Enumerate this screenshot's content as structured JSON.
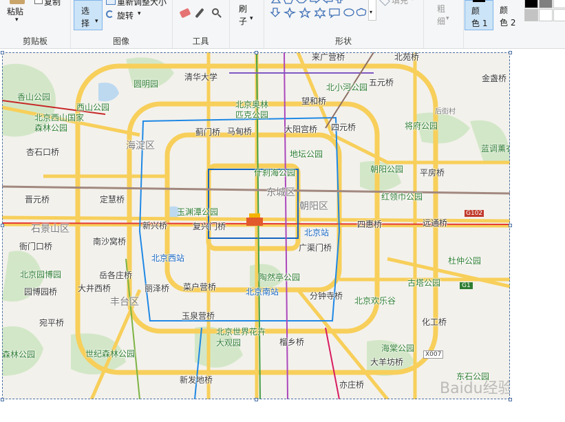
{
  "ribbon": {
    "clipboard": {
      "paste": "粘贴",
      "copy": "复制",
      "label": "剪贴板"
    },
    "image": {
      "select": "选\n择",
      "resize": "重新调整大小",
      "rotate": "旋转",
      "label": "图像"
    },
    "tools": {
      "label": "工具"
    },
    "brush": {
      "label": "刷\n子"
    },
    "shapes": {
      "label": "形状",
      "fill": "填充"
    },
    "size": {
      "label": "粗\n细"
    },
    "color1": "颜\n色 1",
    "color2": "颜\n色 2",
    "swatches": [
      "#000000",
      "#7f7f7f",
      "#ffffff",
      "#c3c3c3",
      "#ffffff",
      "#ffffff"
    ]
  },
  "map": {
    "districts": [
      "海淀区",
      "东城区",
      "朝阳区",
      "石景山区",
      "丰台区"
    ],
    "parks": [
      "香山公园",
      "北京西山国家森林公园",
      "圆明园",
      "北京奥林匹克公园",
      "北小河公园",
      "将府公园",
      "地坛公园",
      "什刹海公园",
      "朝阳公园",
      "红领巾公园",
      "玉渊潭公园",
      "杜仲公园",
      "北京园博园",
      "陶然亭公园",
      "古塔公园",
      "北京欢乐谷",
      "北京世界花卉大观园",
      "海棠公园",
      "世纪森林公园",
      "森林公园",
      "西山公园",
      "蓝调薰衣",
      "东石公园"
    ],
    "places": [
      "清华大学",
      "来广营桥",
      "北苑桥",
      "五元桥",
      "金盏桥",
      "望和桥",
      "四元桥",
      "蓟门桥",
      "马甸桥",
      "大阳宫桥",
      "后街村",
      "杏石口桥",
      "平房桥",
      "晋元桥",
      "定慧桥",
      "新兴桥",
      "复兴门桥",
      "四惠桥",
      "远通桥",
      "衙门口桥",
      "南沙窝桥",
      "广渠门桥",
      "岳各庄桥",
      "大井西桥",
      "丽泽桥",
      "菜户营桥",
      "分钟寺桥",
      "园博园桥",
      "宛平桥",
      "玉泉营桥",
      "化工桥",
      "榴乡桥",
      "大羊坊桥",
      "新发地桥",
      "亦庄桥",
      "北京站",
      "北京西站",
      "北京南站"
    ],
    "road_codes": [
      "G102",
      "G1",
      "X007"
    ],
    "watermark": "Baidu经验"
  }
}
